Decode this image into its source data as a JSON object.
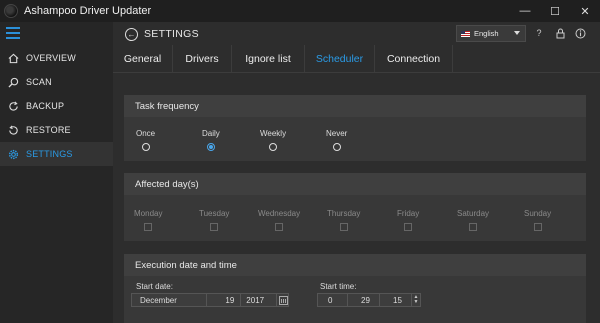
{
  "window": {
    "title": "Ashampoo Driver Updater",
    "controls": {
      "minimize": "—",
      "maximize": "☐",
      "close": "✕"
    }
  },
  "sidebar": {
    "items": [
      {
        "label": "OVERVIEW",
        "icon": "home-icon",
        "active": false
      },
      {
        "label": "SCAN",
        "icon": "search-icon",
        "active": false
      },
      {
        "label": "BACKUP",
        "icon": "backup-icon",
        "active": false
      },
      {
        "label": "RESTORE",
        "icon": "restore-icon",
        "active": false
      },
      {
        "label": "SETTINGS",
        "icon": "gear-icon",
        "active": true
      }
    ]
  },
  "header": {
    "title": "SETTINGS",
    "language": "English",
    "icons": [
      "help-icon",
      "lock-icon",
      "info-icon"
    ]
  },
  "tabs": [
    {
      "label": "General",
      "active": false
    },
    {
      "label": "Drivers",
      "active": false
    },
    {
      "label": "Ignore list",
      "active": false
    },
    {
      "label": "Scheduler",
      "active": true
    },
    {
      "label": "Connection",
      "active": false
    }
  ],
  "task_frequency": {
    "title": "Task frequency",
    "options": [
      {
        "label": "Once",
        "checked": false
      },
      {
        "label": "Daily",
        "checked": true
      },
      {
        "label": "Weekly",
        "checked": false
      },
      {
        "label": "Never",
        "checked": false
      }
    ]
  },
  "affected_days": {
    "title": "Affected day(s)",
    "days": [
      "Monday",
      "Tuesday",
      "Wednesday",
      "Thursday",
      "Friday",
      "Saturday",
      "Sunday"
    ]
  },
  "execution": {
    "title": "Execution date and time",
    "start_date_label": "Start date:",
    "start_date": {
      "month": "December",
      "day": "19",
      "year": "2017"
    },
    "start_time_label": "Start time:",
    "start_time": {
      "hour": "0",
      "minute": "29",
      "second": "15"
    }
  },
  "colors": {
    "accent": "#2b9be6",
    "background": "#2d2d2d",
    "sidebar": "#262626",
    "titlebar": "#1f1f1f",
    "panel": "#383838"
  }
}
